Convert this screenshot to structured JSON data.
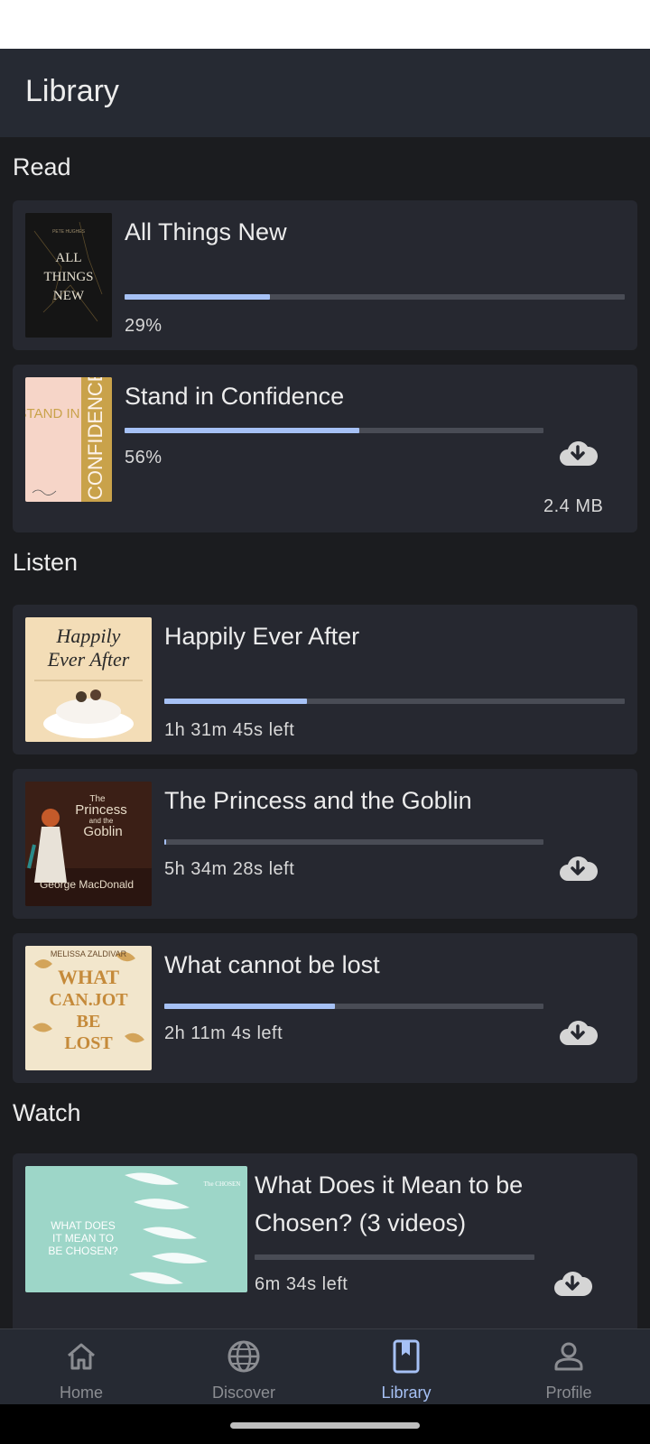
{
  "appbar": {
    "title": "Library"
  },
  "sections": {
    "read": {
      "title": "Read",
      "items": [
        {
          "title": "All Things New",
          "meta": "29%",
          "progress": 0.29,
          "size": ""
        },
        {
          "title": "Stand in Confidence",
          "meta": "56%",
          "progress": 0.56,
          "size": "2.4 MB"
        }
      ]
    },
    "listen": {
      "title": "Listen",
      "items": [
        {
          "title": "Happily Ever After",
          "meta": "1h 31m 45s left",
          "progress": 0.31
        },
        {
          "title": "The Princess and the Goblin",
          "meta": "5h 34m 28s left",
          "progress": 0.003
        },
        {
          "title": "What cannot be lost",
          "meta": "2h 11m 4s left",
          "progress": 0.45
        }
      ]
    },
    "watch": {
      "title": "Watch",
      "items": [
        {
          "title": "What Does it Mean to be Chosen? (3 videos)",
          "meta": "6m 34s left",
          "progress": 0.0
        }
      ]
    }
  },
  "covers": {
    "all_things_new": {
      "author": "PETE HUGHES",
      "line1": "ALL",
      "line2": "THINGS",
      "line3": "NEW"
    },
    "stand_in_confidence": {
      "left": "STAND IN",
      "spine": "CONFIDENCE"
    },
    "happily_ever_after": {
      "line1": "Happily",
      "line2": "Ever After"
    },
    "princess_goblin": {
      "line1": "The",
      "line2": "Princess",
      "line3": "and the",
      "line4": "Goblin",
      "author": "George MacDonald"
    },
    "what_cannot_be_lost": {
      "author": "MELISSA ZALDIVAR",
      "line1": "WHAT",
      "line2": "CAN.JOT",
      "line3": "BE",
      "line4": "LOST"
    },
    "chosen": {
      "line1": "WHAT DOES",
      "line2": "IT MEAN TO",
      "line3": "BE CHOSEN?",
      "badge": "The CHOSEN"
    }
  },
  "nav": {
    "items": [
      {
        "label": "Home",
        "icon": "home-icon"
      },
      {
        "label": "Discover",
        "icon": "globe-icon"
      },
      {
        "label": "Library",
        "icon": "bookmark-book-icon",
        "active": true
      },
      {
        "label": "Profile",
        "icon": "person-icon"
      }
    ]
  },
  "colors": {
    "background": "#1b1c1f",
    "card": "#262830",
    "appbar": "#262a33",
    "accent": "#a6c1f5",
    "track": "#494c55"
  }
}
